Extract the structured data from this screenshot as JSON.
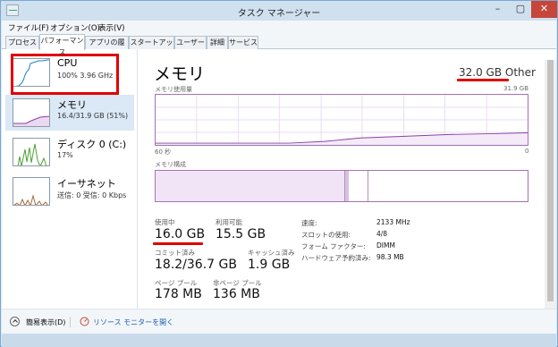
{
  "window": {
    "title": "タスク マネージャー"
  },
  "menu": [
    "ファイル(F)",
    "オプション(O)",
    "表示(V)"
  ],
  "tabs": [
    "プロセス",
    "パフォーマンス",
    "アプリの履歴",
    "スタートアップ",
    "ユーザー",
    "詳細",
    "サービス"
  ],
  "sidebar": {
    "items": [
      {
        "name": "CPU",
        "sub": "100% 3.96 GHz"
      },
      {
        "name": "メモリ",
        "sub": "16.4/31.9 GB (51%)"
      },
      {
        "name": "ディスク 0 (C:)",
        "sub": "17%"
      },
      {
        "name": "イーサネット",
        "sub": "送信: 0 受信: 0 Kbps"
      }
    ]
  },
  "detail": {
    "title": "メモリ",
    "total": "32.0 GB Other",
    "usage_label": "メモリ使用量",
    "usage_max": "31.9 GB",
    "time_left": "60 秒",
    "time_right": "0",
    "composition_label": "メモリ構成",
    "stats": {
      "in_use_label": "使用中",
      "in_use": "16.0 GB",
      "available_label": "利用可能",
      "available": "15.5 GB",
      "committed_label": "コミット済み",
      "committed": "18.2/36.7 GB",
      "cached_label": "キャッシュ済み",
      "cached": "1.9 GB",
      "paged_label": "ページ プール",
      "paged": "178 MB",
      "nonpaged_label": "非ページ プール",
      "nonpaged": "136 MB"
    },
    "right": [
      {
        "label": "速度:",
        "value": "2133 MHz"
      },
      {
        "label": "スロットの使用:",
        "value": "4/8"
      },
      {
        "label": "フォーム ファクター:",
        "value": "DIMM"
      },
      {
        "label": "ハードウェア予約済み:",
        "value": "98.3 MB"
      }
    ]
  },
  "footer": {
    "fewer_details": "簡易表示(D)",
    "resource_monitor": "リソース モニターを開く"
  },
  "colors": {
    "memory": "#8b3fa8",
    "cpu": "#1e7fc8",
    "disk": "#4ea232",
    "ethernet": "#a4683c",
    "annotation": "#e00000"
  }
}
